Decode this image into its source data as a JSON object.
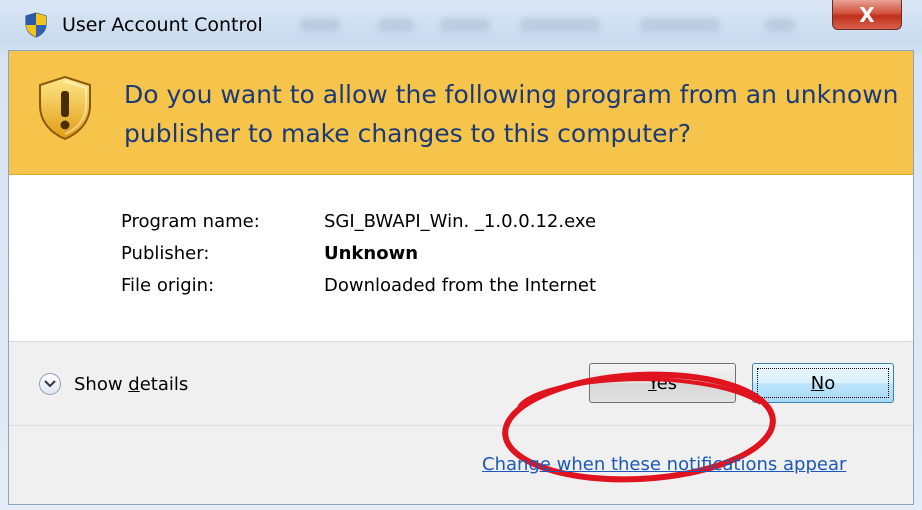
{
  "window": {
    "title": "User Account Control",
    "close_glyph": "X"
  },
  "banner": {
    "question": "Do you want to allow the following program from an unknown publisher to make changes to this computer?"
  },
  "program_info": {
    "rows": [
      {
        "label": "Program name:",
        "value": "SGI_BWAPI_Win. _1.0.0.12.exe"
      },
      {
        "label": "Publisher:",
        "value": "Unknown"
      },
      {
        "label": "File origin:",
        "value": "Downloaded from the Internet"
      }
    ]
  },
  "footer": {
    "show_details_prefix": "Show ",
    "show_details_accel": "d",
    "show_details_suffix": "etails",
    "yes_accel": "Y",
    "yes_rest": "es",
    "no_accel": "N",
    "no_rest": "o",
    "link": "Change when these notifications appear"
  },
  "colors": {
    "banner": "#f6c44a",
    "banner_text": "#1a3a78",
    "link": "#1b58b8",
    "annotation_ring": "#e0141e"
  },
  "icons": [
    "uac-shield-icon",
    "warning-shield-icon",
    "chevron-down-icon",
    "close-icon"
  ]
}
